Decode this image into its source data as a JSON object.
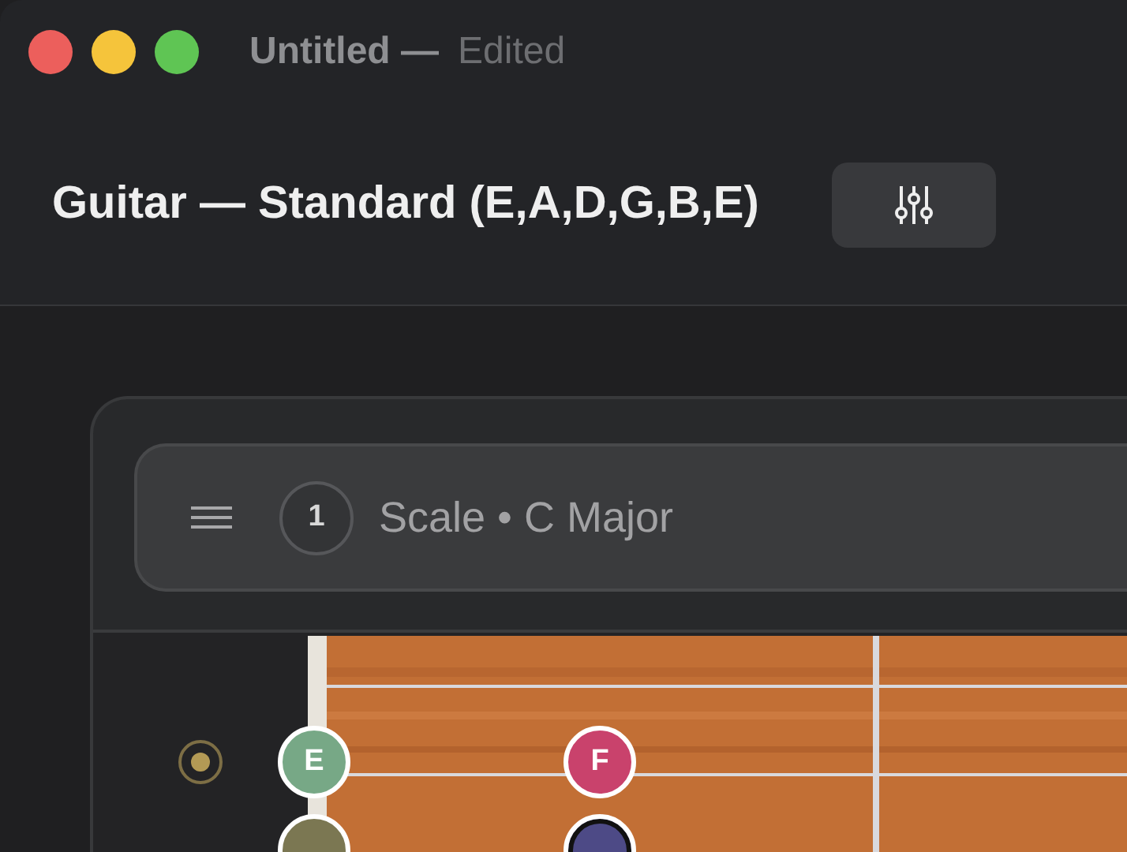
{
  "window": {
    "title": "Untitled —",
    "status": "Edited"
  },
  "header": {
    "title": "Guitar — Standard (E,A,D,G,B,E)"
  },
  "layer": {
    "number": "1",
    "title": "Scale • C Major"
  },
  "strings": [
    {
      "selected": true,
      "notes": [
        {
          "label": "E",
          "color": "#77a886"
        },
        {
          "label": "F",
          "color": "#c9426c"
        }
      ]
    },
    {
      "notes": [
        {
          "color": "#7b7752"
        },
        {
          "color": "#4d4a86",
          "kind": "root"
        }
      ]
    }
  ]
}
